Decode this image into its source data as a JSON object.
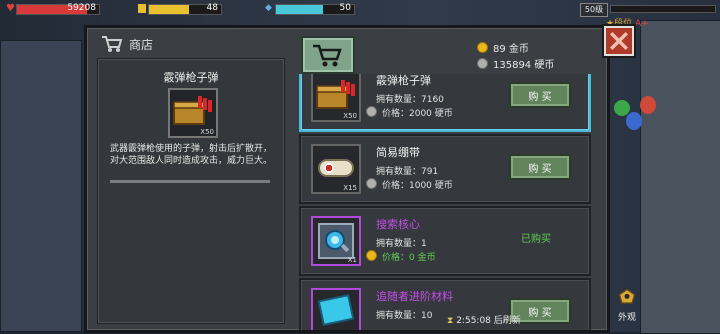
{
  "hud": {
    "hp_value": "59208",
    "hp_fill": 0.85,
    "energy_value": "48",
    "energy_fill": 0.55,
    "mana_value": "50",
    "mana_fill": 0.6,
    "level": "50级",
    "rank": "段位",
    "rank_grade": "A+"
  },
  "shop": {
    "title": "商店",
    "gold": "89 金币",
    "silver": "135894 硬币",
    "refresh_text": "2:55:08 后刷新",
    "appearance_label": "外观"
  },
  "detail": {
    "name": "霰弹枪子弹",
    "icon_count": "X50",
    "description": "武器霰弹枪使用的子弹，射击后扩散开，对大范围敌人同时造成攻击，威力巨大。"
  },
  "items": [
    {
      "name": "霰弹枪子弹",
      "owned": "拥有数量：7160",
      "price": "价格：2000 硬币",
      "action": "购 买",
      "icon_count": "X50"
    },
    {
      "name": "简易绷带",
      "owned": "拥有数量：791",
      "price": "价格：1000 硬币",
      "action": "购 买",
      "icon_count": "X15"
    },
    {
      "name": "搜索核心",
      "owned": "拥有数量：1",
      "price": "价格：0 金币",
      "action": "已购买",
      "icon_count": "X1"
    },
    {
      "name": "追随者进阶材料",
      "owned": "拥有数量：10",
      "price": "",
      "action": "购 买",
      "icon_count": ""
    }
  ],
  "colors": {
    "accent": "#4ab8d8",
    "buy_button": "#62845c",
    "purchased": "#5cd050",
    "rare_name": "#c64ee8",
    "close": "#b03a2a"
  }
}
